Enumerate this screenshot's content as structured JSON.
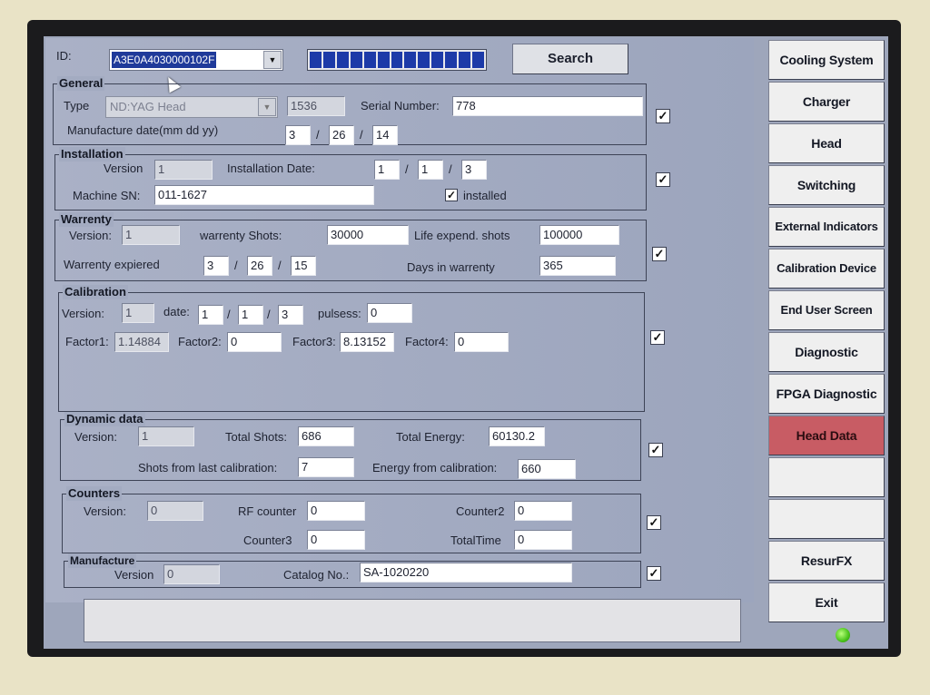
{
  "header": {
    "id_label": "ID:",
    "id_value": "A3E0A4030000102F",
    "search_label": "Search"
  },
  "general": {
    "title": "General",
    "type_label": "Type",
    "type_value": "ND:YAG Head",
    "type_code": "1536",
    "serial_label": "Serial Number:",
    "serial_value": "778",
    "mfg_label": "Manufacture date(mm dd yy)",
    "mfg_mm": "3",
    "mfg_dd": "26",
    "mfg_yy": "14"
  },
  "installation": {
    "title": "Installation",
    "version_label": "Version",
    "version_value": "1",
    "date_label": "Installation Date:",
    "date_mm": "1",
    "date_dd": "1",
    "date_yy": "3",
    "machine_label": "Machine SN:",
    "machine_value": "011-1627",
    "installed_label": "installed"
  },
  "warrenty": {
    "title": "Warrenty",
    "version_label": "Version:",
    "version_value": "1",
    "shots_label": "warrenty Shots:",
    "shots_value": "30000",
    "life_label": "Life expend. shots",
    "life_value": "100000",
    "expired_label": "Warrenty expiered",
    "exp_mm": "3",
    "exp_dd": "26",
    "exp_yy": "15",
    "days_label": "Days in warrenty",
    "days_value": "365"
  },
  "calibration": {
    "title": "Calibration",
    "version_label": "Version:",
    "version_value": "1",
    "date_label": "date:",
    "date_mm": "1",
    "date_dd": "1",
    "date_yy": "3",
    "pulses_label": "pulsess:",
    "pulses_value": "0",
    "f1_label": "Factor1:",
    "f1_value": "1.14884",
    "f2_label": "Factor2:",
    "f2_value": "0",
    "f3_label": "Factor3:",
    "f3_value": "8.13152",
    "f4_label": "Factor4:",
    "f4_value": "0"
  },
  "dynamic": {
    "title": "Dynamic data",
    "version_label": "Version:",
    "version_value": "1",
    "total_shots_label": "Total Shots:",
    "total_shots_value": "686",
    "total_energy_label": "Total Energy:",
    "total_energy_value": "60130.2",
    "shots_cal_label": "Shots from last calibration:",
    "shots_cal_value": "7",
    "energy_cal_label": "Energy from calibration:",
    "energy_cal_value": "660"
  },
  "counters": {
    "title": "Counters",
    "version_label": "Version:",
    "version_value": "0",
    "rf_label": "RF counter",
    "rf_value": "0",
    "c2_label": "Counter2",
    "c2_value": "0",
    "c3_label": "Counter3",
    "c3_value": "0",
    "tt_label": "TotalTime",
    "tt_value": "0"
  },
  "manufacture": {
    "title": "Manufacture",
    "version_label": "Version",
    "version_value": "0",
    "catalog_label": "Catalog No.:",
    "catalog_value": "SA-1020220"
  },
  "sidebar": {
    "items": [
      "Cooling System",
      "Charger",
      "Head",
      "Switching",
      "External Indicators",
      "Calibration Device",
      "End User Screen",
      "Diagnostic",
      "FPGA Diagnostic",
      "Head Data",
      "",
      "",
      "ResurFX",
      "Exit"
    ],
    "active": "Head Data"
  },
  "colors": {
    "active_nav": "#c85c64",
    "id_highlight": "#1f3a9a",
    "progress": "#1c3aa8",
    "status_led": "#48c21a"
  }
}
